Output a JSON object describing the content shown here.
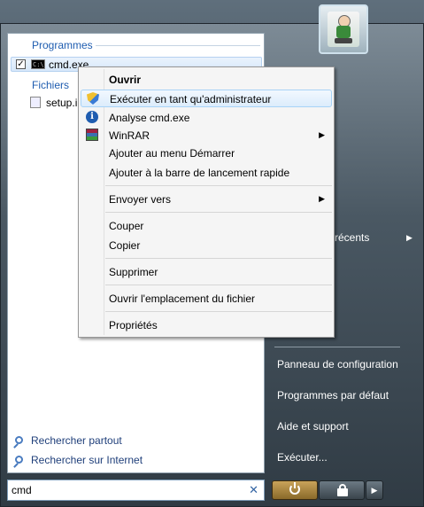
{
  "left_pane": {
    "programs_header": "Programmes",
    "program_item": "cmd.exe",
    "files_header": "Fichiers",
    "file_item": "setup.i",
    "search_everywhere": "Rechercher partout",
    "search_internet": "Rechercher sur Internet"
  },
  "search": {
    "value": "cmd",
    "clear_glyph": "✕"
  },
  "right_pane": {
    "recent_label": "récents",
    "control_panel": "Panneau de configuration",
    "default_programs": "Programmes par défaut",
    "help": "Aide et support",
    "run": "Exécuter..."
  },
  "context_menu": {
    "open": "Ouvrir",
    "run_as_admin": "Exécuter en tant qu'administrateur",
    "scan": "Analyse cmd.exe",
    "winrar": "WinRAR",
    "add_start": "Ajouter au menu Démarrer",
    "add_quicklaunch": "Ajouter à la barre de lancement rapide",
    "send_to": "Envoyer vers",
    "cut": "Couper",
    "copy": "Copier",
    "delete": "Supprimer",
    "open_location": "Ouvrir l'emplacement du fichier",
    "properties": "Propriétés"
  },
  "glyphs": {
    "submenu_arrow": "▶",
    "check": "✓",
    "cmd_icon_text": "C:\\",
    "info_icon_text": "i"
  }
}
